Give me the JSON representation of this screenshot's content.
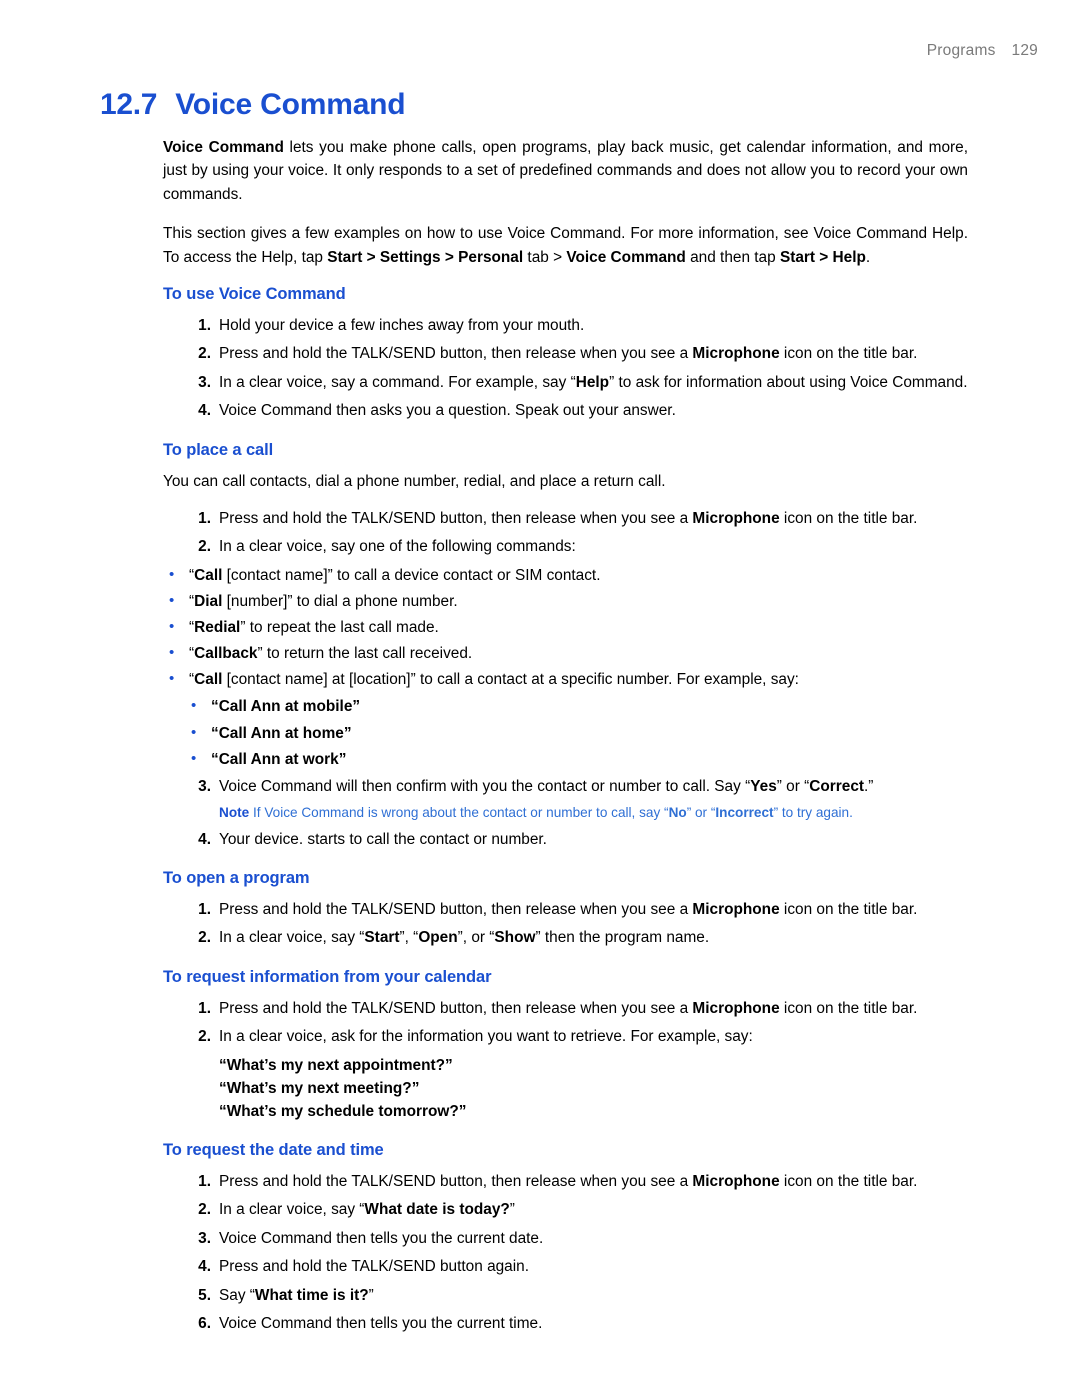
{
  "header": {
    "section": "Programs",
    "page_number": "129"
  },
  "title": {
    "number": "12.7",
    "text": "Voice Command"
  },
  "intro": {
    "p1_bold": "Voice Command",
    "p1_rest": " lets you make phone calls, open programs, play back music, get calendar information, and more, just by using your voice. It only responds to a set of predefined commands and does not allow you to record your own commands.",
    "p2_a": "This section gives a few examples on how to use Voice Command. For more information, see Voice Command Help. To access the Help, tap ",
    "p2_b1": "Start > Settings > Personal",
    "p2_b2": " tab > ",
    "p2_b3": "Voice Command",
    "p2_b4": " and then tap ",
    "p2_b5": "Start > Help",
    "p2_end": "."
  },
  "sections": [
    {
      "heading": "To use Voice Command",
      "steps": [
        {
          "num": "1.",
          "text": "Hold your device a few inches away from your mouth."
        },
        {
          "num": "2.",
          "pre": "Press and hold the TALK/SEND button, then release when you see a ",
          "bold": "Microphone",
          "post": " icon on the title bar."
        },
        {
          "num": "3.",
          "pre": "In a clear voice, say a command. For example, say “",
          "bold": "Help",
          "post": "” to ask for information about using Voice Command."
        },
        {
          "num": "4.",
          "text": "Voice Command then asks you a question. Speak out your answer."
        }
      ]
    },
    {
      "heading": "To place a call",
      "lead": "You can call contacts, dial a phone number, redial, and place a return call.",
      "steps": [
        {
          "num": "1.",
          "pre": "Press and hold the TALK/SEND button, then release when you see a ",
          "bold": "Microphone",
          "post": " icon on the title bar."
        },
        {
          "num": "2.",
          "text": "In a clear voice, say one of the following commands:"
        }
      ],
      "bullets": [
        {
          "pre": "“",
          "bold": "Call",
          "post": " [contact name]” to call a device contact or SIM contact."
        },
        {
          "pre": "“",
          "bold": "Dial",
          "post": " [number]” to dial a phone number."
        },
        {
          "pre": "“",
          "bold": "Redial",
          "post": "” to repeat the last call made."
        },
        {
          "pre": "“",
          "bold": "Callback",
          "post": "” to return the last call received."
        },
        {
          "pre": "“",
          "bold": "Call",
          "post": " [contact name] at [location]” to call a contact at a specific number. For example, say:"
        }
      ],
      "inner_bullets": [
        "“Call Ann at mobile”",
        "“Call Ann at home”",
        "“Call Ann at work”"
      ],
      "steps2": [
        {
          "num": "3.",
          "pre": "Voice Command will then confirm with you the contact or number to call. Say “",
          "bold": "Yes",
          "mid": "” or “",
          "bold2": "Correct",
          "post": ".”"
        }
      ],
      "note": {
        "label": "Note",
        "pre": "  If Voice Command is wrong about the contact or number to call, say “",
        "bold": "No",
        "mid": "” or “",
        "bold2": "Incorrect",
        "post": "” to try again."
      },
      "steps3": [
        {
          "num": "4.",
          "text": "Your device. starts to call the contact or number."
        }
      ]
    },
    {
      "heading": "To open a program",
      "steps": [
        {
          "num": "1.",
          "pre": "Press and hold the TALK/SEND button, then release when you see a ",
          "bold": "Microphone",
          "post": " icon on the title bar."
        },
        {
          "num": "2.",
          "pre": "In a clear voice, say “",
          "bold": "Start",
          "mid": "”, “",
          "bold2": "Open",
          "mid2": "”, or “",
          "bold3": "Show",
          "post": "” then the program name."
        }
      ]
    },
    {
      "heading": "To request information from your calendar",
      "steps": [
        {
          "num": "1.",
          "pre": "Press and hold the TALK/SEND button, then release when you see a ",
          "bold": "Microphone",
          "post": " icon on the title bar."
        },
        {
          "num": "2.",
          "text": "In a clear voice, ask for the information you want to retrieve. For example, say:"
        }
      ],
      "examples": [
        "“What’s my next appointment?”",
        "“What’s my next meeting?”",
        "“What’s my schedule tomorrow?”"
      ]
    },
    {
      "heading": "To request the date and time",
      "steps": [
        {
          "num": "1.",
          "pre": "Press and hold the TALK/SEND button, then release when you see a ",
          "bold": "Microphone",
          "post": " icon on the title bar."
        },
        {
          "num": "2.",
          "pre": "In a clear voice, say “",
          "bold": "What date is today?",
          "post": "”"
        },
        {
          "num": "3.",
          "text": "Voice Command then tells you the current date."
        },
        {
          "num": "4.",
          "text": "Press and hold the TALK/SEND button again."
        },
        {
          "num": "5.",
          "pre": "Say “",
          "bold": "What time is it?",
          "post": "”"
        },
        {
          "num": "6.",
          "text": "Voice Command then tells you the current time."
        }
      ]
    }
  ]
}
